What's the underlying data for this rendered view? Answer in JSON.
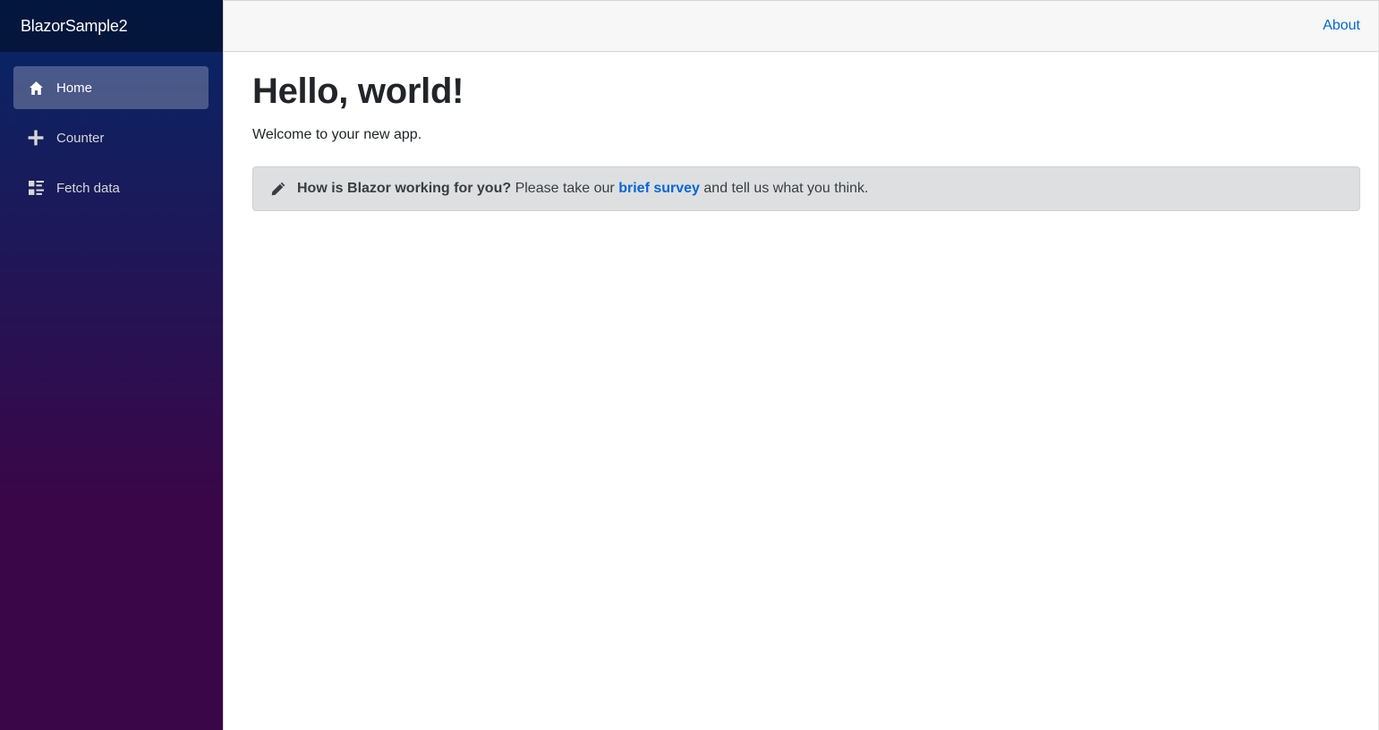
{
  "brand": "BlazorSample2",
  "nav": {
    "items": [
      {
        "label": "Home",
        "icon": "home-icon",
        "active": true
      },
      {
        "label": "Counter",
        "icon": "plus-icon",
        "active": false
      },
      {
        "label": "Fetch data",
        "icon": "list-rich-icon",
        "active": false
      }
    ]
  },
  "top_row": {
    "about_label": "About"
  },
  "page": {
    "title": "Hello, world!",
    "welcome": "Welcome to your new app."
  },
  "survey": {
    "icon": "pencil-icon",
    "question": "How is Blazor working for you?",
    "pre_link": "Please take our",
    "link_label": "brief survey",
    "post_link": "and tell us what you think."
  },
  "colors": {
    "sidebar_top": "#052767",
    "sidebar_bottom": "#3a0647",
    "link": "#0366d6",
    "alert_bg": "#dedfe1"
  }
}
